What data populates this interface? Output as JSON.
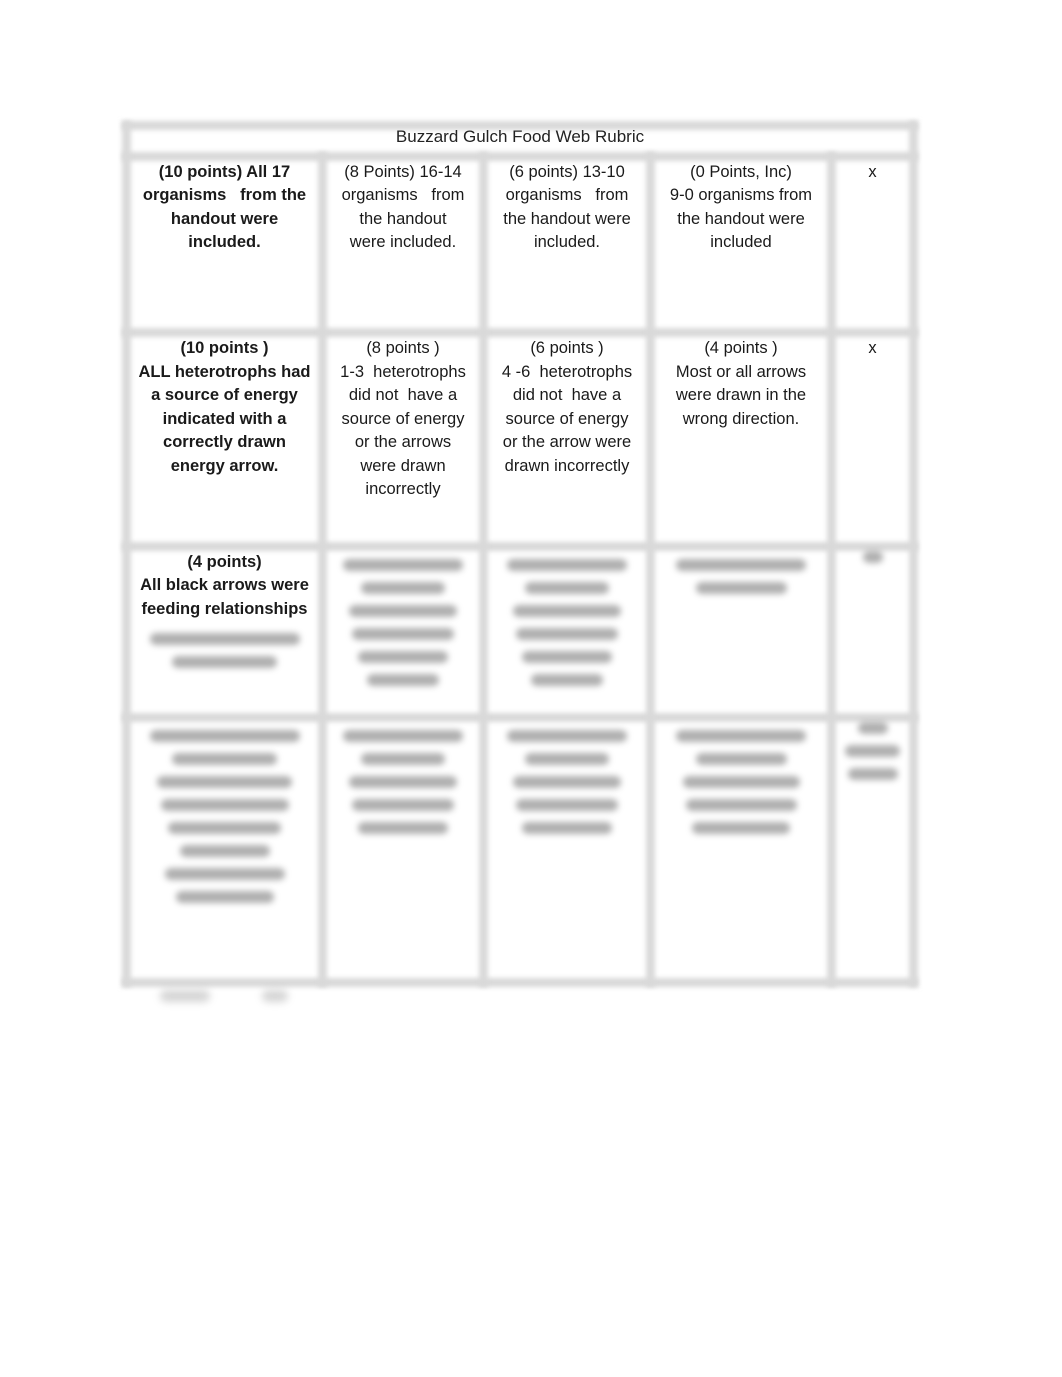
{
  "document": {
    "title": "Buzzard Gulch Food Web Rubric"
  },
  "rubric": {
    "rows": [
      {
        "criterion": {
          "bold": true,
          "lines": [
            "(10 points) All 17",
            "organisms   from the",
            "handout were",
            "included."
          ]
        },
        "levels": [
          {
            "lines": [
              "(8 Points) 16-14",
              "organisms   from",
              "the handout",
              "were included."
            ]
          },
          {
            "lines": [
              "(6 points) 13-10",
              "organisms   from",
              "the handout were",
              "included."
            ]
          },
          {
            "lines": [
              "(0 Points, Inc)",
              "9-0 organisms from",
              "the handout were",
              "included"
            ]
          }
        ],
        "score": "x"
      },
      {
        "criterion": {
          "bold": true,
          "lines": [
            "(10 points )",
            "ALL heterotrophs had",
            "a source of energy",
            "indicated with a",
            "correctly drawn",
            "energy arrow."
          ]
        },
        "levels": [
          {
            "lines": [
              "(8 points )",
              "1-3  heterotrophs",
              "did not  have a",
              "source of energy",
              "or the arrows",
              "were drawn",
              "incorrectly"
            ]
          },
          {
            "lines": [
              "(6 points )",
              "4 -6  heterotrophs",
              "did not  have a",
              "source of energy",
              "or the arrow were",
              "drawn incorrectly"
            ]
          },
          {
            "lines": [
              "(4 points )",
              "Most or all arrows",
              "were drawn in the",
              "wrong direction."
            ]
          }
        ],
        "score": "x"
      },
      {
        "criterion": {
          "bold": true,
          "lines": [
            "(4 points)",
            "All black arrows were",
            "feeding relationships"
          ],
          "obscured_line_count": 2
        },
        "levels": [
          {
            "obscured_line_count": 6
          },
          {
            "obscured_line_count": 6
          },
          {
            "obscured_line_count": 2
          }
        ],
        "score_obscured": true
      },
      {
        "criterion": {
          "obscured_line_count": 8
        },
        "levels": [
          {
            "obscured_line_count": 5
          },
          {
            "obscured_line_count": 5
          },
          {
            "obscured_line_count": 5
          }
        ],
        "score_obscured": true
      }
    ]
  }
}
